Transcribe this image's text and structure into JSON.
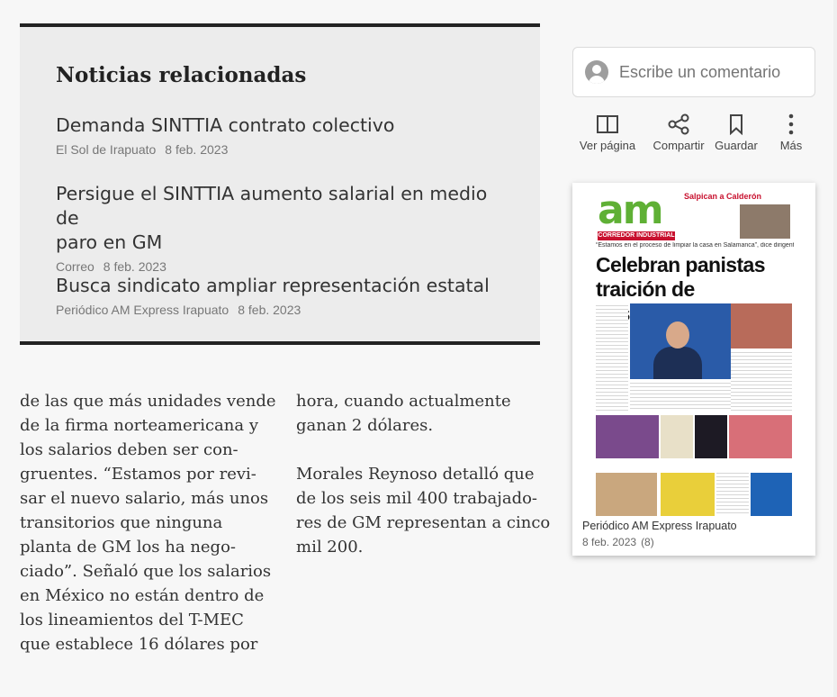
{
  "related": {
    "title": "Noticias relacionadas",
    "items": [
      {
        "headline": "Demanda SINTTIA contrato colectivo",
        "source": "El Sol de Irapuato",
        "date": "8 feb. 2023"
      },
      {
        "headline_line1": "Persigue el SINTTIA aumento salarial en medio de",
        "headline_line2": "paro en GM",
        "source": "Correo",
        "date": "8 feb. 2023"
      },
      {
        "headline": "Busca sindicato ampliar representación estatal",
        "source": "Periódico AM Express Irapuato",
        "date": "8 feb. 2023"
      }
    ]
  },
  "article": {
    "col1": [
      "de las que más unidades vende",
      "de la firma norteamericana y",
      "los salarios deben ser con-",
      "gruentes. “Estamos por revi-",
      "sar el nuevo salario, más unos",
      "transitorios que ninguna",
      "planta de GM los ha nego-",
      "ciado”. Señaló que los salarios",
      "en México no están dentro de",
      "los lineamientos del T-MEC",
      "que establece 16 dólares por"
    ],
    "col2_p1": [
      "hora, cuando actualmente",
      "ganan 2 dólares."
    ],
    "col2_p2": [
      "Morales Reynoso detalló que",
      "de los seis mil 400 trabajado-",
      "res de GM representan a cinco",
      "mil 200."
    ]
  },
  "sidebar": {
    "comment_placeholder": "Escribe un comentario",
    "actions": {
      "view_page": "Ver página",
      "share": "Compartir",
      "save": "Guardar",
      "more": "Más"
    },
    "paper": {
      "logo": "am",
      "logo_strip": "CORREDOR INDUSTRIAL",
      "side_headline": "Salpican a Calderón",
      "strapline": "“Estamos en el proceso de limpiar la casa en Salamanca”, dice dirigente estatal",
      "headline": "Celebran panistas traición de Justino",
      "source": "Periódico AM Express Irapuato",
      "date": "8 feb. 2023",
      "count": "(8)"
    }
  },
  "colors": {
    "accent_green": "#5fb035",
    "accent_red": "#c8102e",
    "panel_bg": "#ececec"
  }
}
